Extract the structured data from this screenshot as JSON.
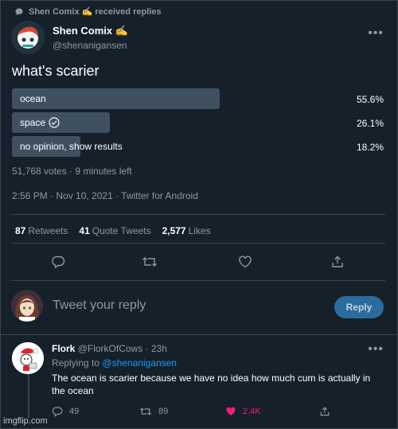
{
  "context": {
    "label": "Shen Comix ✍ received replies",
    "icon": "speech-bubble-icon"
  },
  "tweet": {
    "author_name": "Shen Comix ✍",
    "author_handle": "@shenanigansen",
    "text": "what's scarier",
    "more_icon": "more-horizontal-icon"
  },
  "poll": {
    "options": [
      {
        "label": "ocean",
        "percent_text": "55.6%",
        "percent": 55.6
      },
      {
        "label": "space",
        "percent_text": "26.1%",
        "percent": 26.1,
        "icon": "check-circle-icon"
      },
      {
        "label": "no opinion, show results",
        "percent_text": "18.2%",
        "percent": 18.2
      }
    ],
    "meta": "51,768 votes · 9 minutes left",
    "bar_color": "#3f5161"
  },
  "timestamp": "2:56 PM · Nov 10, 2021 · Twitter for Android",
  "stats": {
    "retweets_count": "87",
    "retweets_label": "Retweets",
    "quotes_count": "41",
    "quotes_label": "Quote Tweets",
    "likes_count": "2,577",
    "likes_label": "Likes"
  },
  "actions": [
    "reply-icon",
    "retweet-icon",
    "like-icon",
    "share-icon"
  ],
  "compose": {
    "placeholder": "Tweet your reply",
    "button_label": "Reply"
  },
  "reply": {
    "name": "Flork",
    "handle_time": "@FlorkOfCows · 23h",
    "replying_prefix": "Replying to",
    "replying_handle": "@shenanigansen",
    "text": "The ocean is scarier because we have no idea how much cum is actually in the ocean",
    "reply_count": "49",
    "retweet_count": "89",
    "like_count": "2.4K",
    "like_color": "#f91880"
  },
  "watermark": "imgflip.com",
  "colors": {
    "background": "#15202b",
    "accent": "#1d9bf0",
    "muted": "#8b98a5"
  }
}
